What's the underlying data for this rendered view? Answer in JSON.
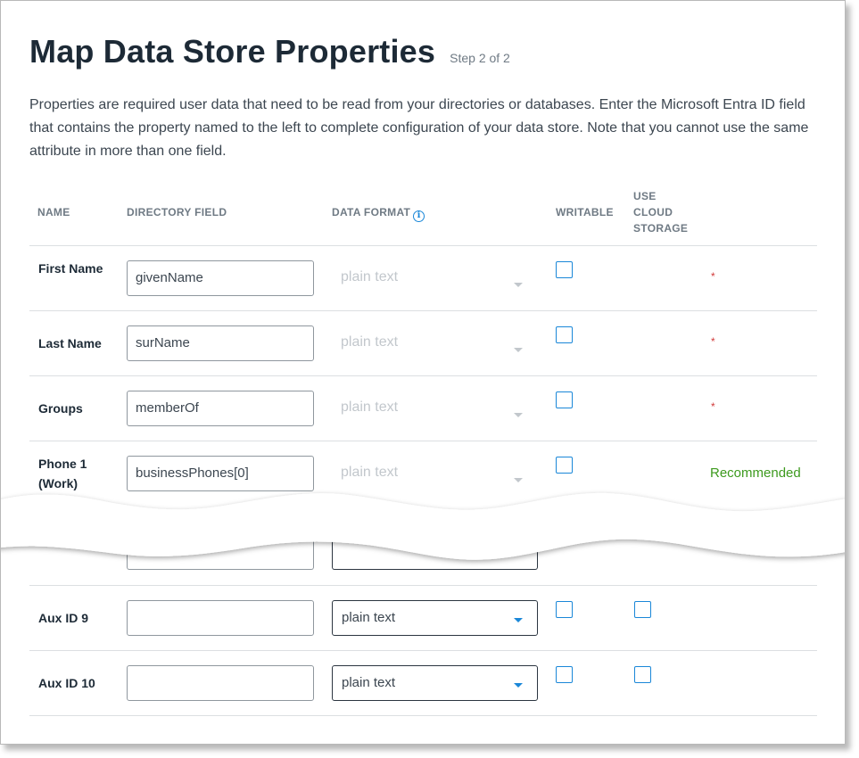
{
  "page": {
    "title": "Map Data Store Properties",
    "step": "Step 2 of 2",
    "description": "Properties are required user data that need to be read from your directories or databases.  Enter the Microsoft Entra ID field that contains the property named to the left to complete configuration of your data store. Note that you cannot use the same attribute in more than one field."
  },
  "columns": {
    "name": "NAME",
    "directory_field": "DIRECTORY FIELD",
    "data_format": "DATA FORMAT",
    "writable": "WRITABLE",
    "use_cloud_storage_1": "USE",
    "use_cloud_storage_2": "CLOUD",
    "use_cloud_storage_3": "STORAGE",
    "info_icon": "info-icon"
  },
  "rows": [
    {
      "name": "First Name",
      "field_value": "givenName",
      "format": "plain text",
      "format_enabled": false,
      "writable": false,
      "status": "*"
    },
    {
      "name": "Last Name",
      "field_value": "surName",
      "format": "plain text",
      "format_enabled": false,
      "writable": false,
      "status": "*"
    },
    {
      "name": "Groups",
      "field_value": "memberOf",
      "format": "plain text",
      "format_enabled": false,
      "writable": false,
      "status": "*"
    },
    {
      "name": "Phone 1 (Work)",
      "field_value": "businessPhones[0]",
      "format": "plain text",
      "format_enabled": false,
      "writable": false,
      "status": "Recommended"
    },
    {
      "name": "Aux ID 9",
      "field_value": "",
      "format": "plain text",
      "format_enabled": true,
      "writable": false,
      "cloud_storage": false
    },
    {
      "name": "Aux ID 10",
      "field_value": "",
      "format": "plain text",
      "format_enabled": true,
      "writable": false,
      "cloud_storage": false
    }
  ],
  "colors": {
    "accent": "#1a87d8",
    "required": "#d13a3a",
    "recommended": "#3d9a1e",
    "title": "#1d2a36"
  }
}
